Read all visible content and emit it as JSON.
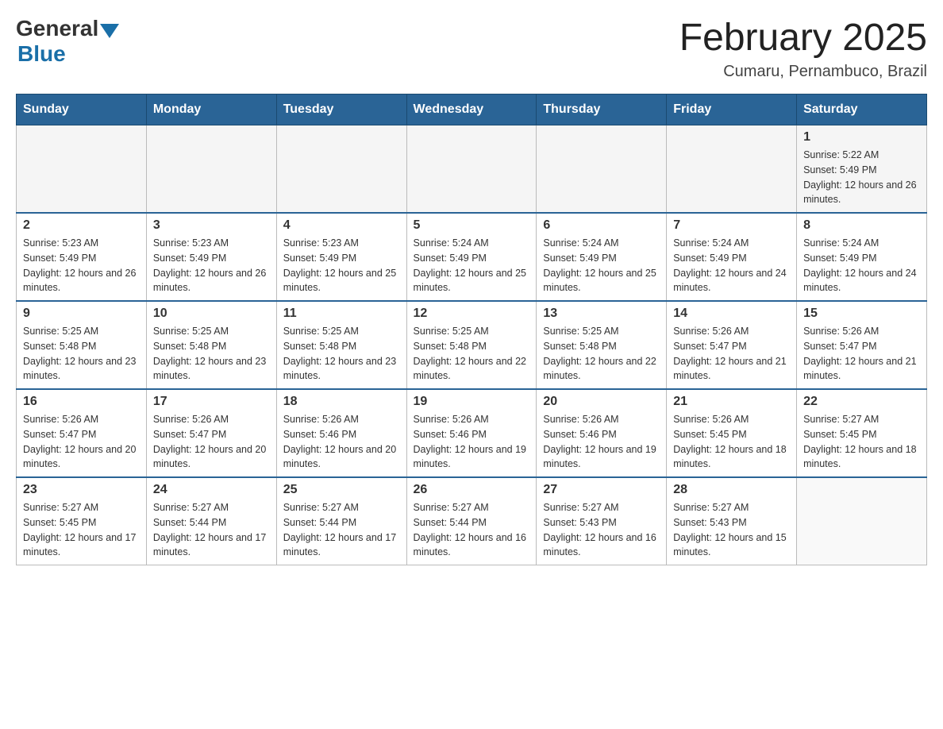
{
  "header": {
    "logo": {
      "general": "General",
      "blue": "Blue"
    },
    "title": "February 2025",
    "location": "Cumaru, Pernambuco, Brazil"
  },
  "days_of_week": [
    "Sunday",
    "Monday",
    "Tuesday",
    "Wednesday",
    "Thursday",
    "Friday",
    "Saturday"
  ],
  "weeks": [
    {
      "days": [
        {
          "number": "",
          "info": ""
        },
        {
          "number": "",
          "info": ""
        },
        {
          "number": "",
          "info": ""
        },
        {
          "number": "",
          "info": ""
        },
        {
          "number": "",
          "info": ""
        },
        {
          "number": "",
          "info": ""
        },
        {
          "number": "1",
          "info": "Sunrise: 5:22 AM\nSunset: 5:49 PM\nDaylight: 12 hours and 26 minutes."
        }
      ]
    },
    {
      "days": [
        {
          "number": "2",
          "info": "Sunrise: 5:23 AM\nSunset: 5:49 PM\nDaylight: 12 hours and 26 minutes."
        },
        {
          "number": "3",
          "info": "Sunrise: 5:23 AM\nSunset: 5:49 PM\nDaylight: 12 hours and 26 minutes."
        },
        {
          "number": "4",
          "info": "Sunrise: 5:23 AM\nSunset: 5:49 PM\nDaylight: 12 hours and 25 minutes."
        },
        {
          "number": "5",
          "info": "Sunrise: 5:24 AM\nSunset: 5:49 PM\nDaylight: 12 hours and 25 minutes."
        },
        {
          "number": "6",
          "info": "Sunrise: 5:24 AM\nSunset: 5:49 PM\nDaylight: 12 hours and 25 minutes."
        },
        {
          "number": "7",
          "info": "Sunrise: 5:24 AM\nSunset: 5:49 PM\nDaylight: 12 hours and 24 minutes."
        },
        {
          "number": "8",
          "info": "Sunrise: 5:24 AM\nSunset: 5:49 PM\nDaylight: 12 hours and 24 minutes."
        }
      ]
    },
    {
      "days": [
        {
          "number": "9",
          "info": "Sunrise: 5:25 AM\nSunset: 5:48 PM\nDaylight: 12 hours and 23 minutes."
        },
        {
          "number": "10",
          "info": "Sunrise: 5:25 AM\nSunset: 5:48 PM\nDaylight: 12 hours and 23 minutes."
        },
        {
          "number": "11",
          "info": "Sunrise: 5:25 AM\nSunset: 5:48 PM\nDaylight: 12 hours and 23 minutes."
        },
        {
          "number": "12",
          "info": "Sunrise: 5:25 AM\nSunset: 5:48 PM\nDaylight: 12 hours and 22 minutes."
        },
        {
          "number": "13",
          "info": "Sunrise: 5:25 AM\nSunset: 5:48 PM\nDaylight: 12 hours and 22 minutes."
        },
        {
          "number": "14",
          "info": "Sunrise: 5:26 AM\nSunset: 5:47 PM\nDaylight: 12 hours and 21 minutes."
        },
        {
          "number": "15",
          "info": "Sunrise: 5:26 AM\nSunset: 5:47 PM\nDaylight: 12 hours and 21 minutes."
        }
      ]
    },
    {
      "days": [
        {
          "number": "16",
          "info": "Sunrise: 5:26 AM\nSunset: 5:47 PM\nDaylight: 12 hours and 20 minutes."
        },
        {
          "number": "17",
          "info": "Sunrise: 5:26 AM\nSunset: 5:47 PM\nDaylight: 12 hours and 20 minutes."
        },
        {
          "number": "18",
          "info": "Sunrise: 5:26 AM\nSunset: 5:46 PM\nDaylight: 12 hours and 20 minutes."
        },
        {
          "number": "19",
          "info": "Sunrise: 5:26 AM\nSunset: 5:46 PM\nDaylight: 12 hours and 19 minutes."
        },
        {
          "number": "20",
          "info": "Sunrise: 5:26 AM\nSunset: 5:46 PM\nDaylight: 12 hours and 19 minutes."
        },
        {
          "number": "21",
          "info": "Sunrise: 5:26 AM\nSunset: 5:45 PM\nDaylight: 12 hours and 18 minutes."
        },
        {
          "number": "22",
          "info": "Sunrise: 5:27 AM\nSunset: 5:45 PM\nDaylight: 12 hours and 18 minutes."
        }
      ]
    },
    {
      "days": [
        {
          "number": "23",
          "info": "Sunrise: 5:27 AM\nSunset: 5:45 PM\nDaylight: 12 hours and 17 minutes."
        },
        {
          "number": "24",
          "info": "Sunrise: 5:27 AM\nSunset: 5:44 PM\nDaylight: 12 hours and 17 minutes."
        },
        {
          "number": "25",
          "info": "Sunrise: 5:27 AM\nSunset: 5:44 PM\nDaylight: 12 hours and 17 minutes."
        },
        {
          "number": "26",
          "info": "Sunrise: 5:27 AM\nSunset: 5:44 PM\nDaylight: 12 hours and 16 minutes."
        },
        {
          "number": "27",
          "info": "Sunrise: 5:27 AM\nSunset: 5:43 PM\nDaylight: 12 hours and 16 minutes."
        },
        {
          "number": "28",
          "info": "Sunrise: 5:27 AM\nSunset: 5:43 PM\nDaylight: 12 hours and 15 minutes."
        },
        {
          "number": "",
          "info": ""
        }
      ]
    }
  ]
}
